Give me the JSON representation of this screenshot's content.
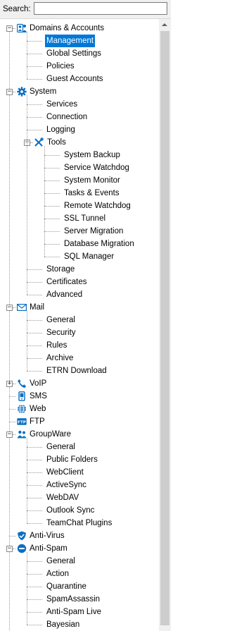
{
  "search": {
    "label": "Search:",
    "value": ""
  },
  "colors": {
    "icon_blue": "#0b6fc2",
    "selection": "#0078d7"
  },
  "tree": [
    {
      "label": "Domains & Accounts",
      "icon": "domains-accounts-icon",
      "expanded": true,
      "children": [
        {
          "label": "Management",
          "selected": true
        },
        {
          "label": "Global Settings"
        },
        {
          "label": "Policies"
        },
        {
          "label": "Guest Accounts"
        }
      ]
    },
    {
      "label": "System",
      "icon": "gear-icon",
      "expanded": true,
      "children": [
        {
          "label": "Services"
        },
        {
          "label": "Connection"
        },
        {
          "label": "Logging"
        },
        {
          "label": "Tools",
          "icon": "tools-icon",
          "expanded": true,
          "children": [
            {
              "label": "System Backup"
            },
            {
              "label": "Service Watchdog"
            },
            {
              "label": "System Monitor"
            },
            {
              "label": "Tasks & Events"
            },
            {
              "label": "Remote Watchdog"
            },
            {
              "label": "SSL Tunnel"
            },
            {
              "label": "Server Migration"
            },
            {
              "label": "Database Migration"
            },
            {
              "label": "SQL Manager"
            }
          ]
        },
        {
          "label": "Storage"
        },
        {
          "label": "Certificates"
        },
        {
          "label": "Advanced"
        }
      ]
    },
    {
      "label": "Mail",
      "icon": "mail-icon",
      "expanded": true,
      "children": [
        {
          "label": "General"
        },
        {
          "label": "Security"
        },
        {
          "label": "Rules"
        },
        {
          "label": "Archive"
        },
        {
          "label": "ETRN Download"
        }
      ]
    },
    {
      "label": "VoIP",
      "icon": "phone-icon",
      "expanded": false,
      "collapsible": true
    },
    {
      "label": "SMS",
      "icon": "sms-icon"
    },
    {
      "label": "Web",
      "icon": "globe-icon"
    },
    {
      "label": "FTP",
      "icon": "ftp-icon"
    },
    {
      "label": "GroupWare",
      "icon": "groupware-icon",
      "expanded": true,
      "children": [
        {
          "label": "General"
        },
        {
          "label": "Public Folders"
        },
        {
          "label": "WebClient"
        },
        {
          "label": "ActiveSync"
        },
        {
          "label": "WebDAV"
        },
        {
          "label": "Outlook Sync"
        },
        {
          "label": "TeamChat Plugins"
        }
      ]
    },
    {
      "label": "Anti-Virus",
      "icon": "shield-icon"
    },
    {
      "label": "Anti-Spam",
      "icon": "no-entry-icon",
      "expanded": true,
      "children": [
        {
          "label": "General"
        },
        {
          "label": "Action"
        },
        {
          "label": "Quarantine"
        },
        {
          "label": "SpamAssassin"
        },
        {
          "label": "Anti-Spam Live"
        },
        {
          "label": "Bayesian"
        }
      ]
    }
  ]
}
